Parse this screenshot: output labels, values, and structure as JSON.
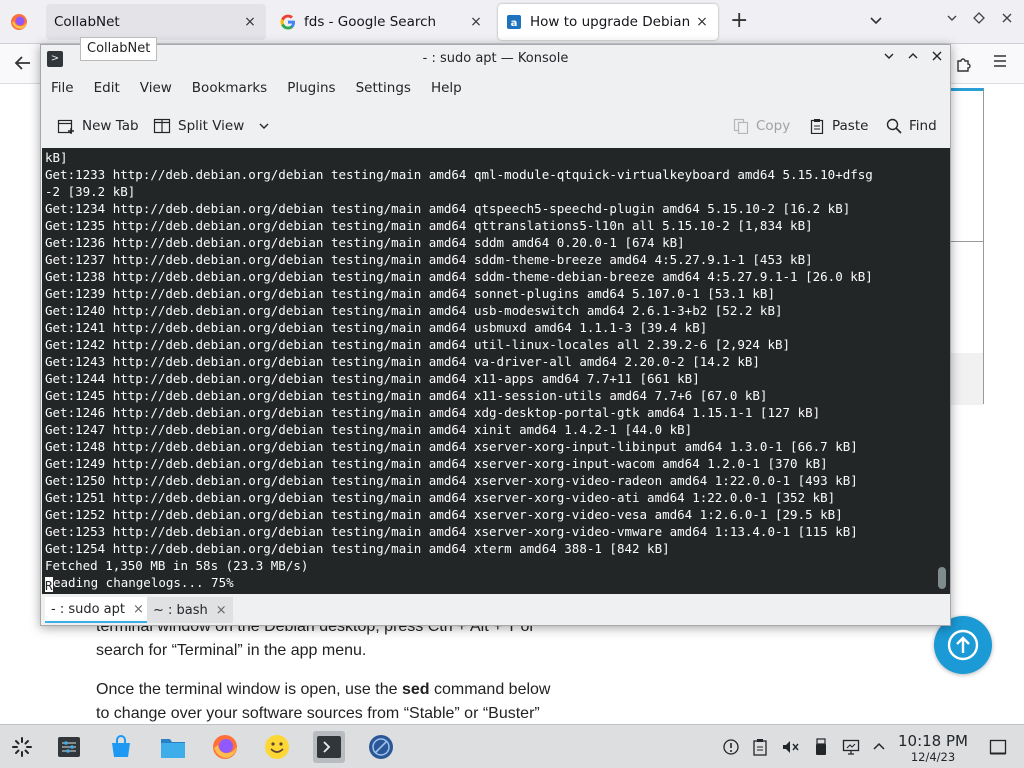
{
  "browser": {
    "tabs": [
      {
        "title": "CollabNet",
        "icon": "collabnet-favicon"
      },
      {
        "title": "fds - Google Search",
        "icon": "google-favicon"
      },
      {
        "title": "How to upgrade Debian di",
        "icon": "article-favicon"
      }
    ],
    "tooltip": "CollabNet",
    "new_tab": "+",
    "tab_close": "×"
  },
  "page": {
    "partial_paragraph": "terminal window on the Debian desktop, press Ctrl + Alt + T or search for “Terminal” in the app menu.",
    "paragraph_pre": "Once the terminal window is open, use the ",
    "paragraph_bold": "sed",
    "paragraph_post": " command below to change over your software sources from “Stable” or “Buster”"
  },
  "konsole": {
    "title": "- : sudo apt — Konsole",
    "menu": [
      "File",
      "Edit",
      "View",
      "Bookmarks",
      "Plugins",
      "Settings",
      "Help"
    ],
    "toolbar": {
      "new_tab": "New Tab",
      "split_view": "Split View",
      "copy": "Copy",
      "paste": "Paste",
      "find": "Find"
    },
    "terminal_lines": [
      "kB]",
      "Get:1233 http://deb.debian.org/debian testing/main amd64 qml-module-qtquick-virtualkeyboard amd64 5.15.10+dfsg",
      "-2 [39.2 kB]",
      "Get:1234 http://deb.debian.org/debian testing/main amd64 qtspeech5-speechd-plugin amd64 5.15.10-2 [16.2 kB]",
      "Get:1235 http://deb.debian.org/debian testing/main amd64 qttranslations5-l10n all 5.15.10-2 [1,834 kB]",
      "Get:1236 http://deb.debian.org/debian testing/main amd64 sddm amd64 0.20.0-1 [674 kB]",
      "Get:1237 http://deb.debian.org/debian testing/main amd64 sddm-theme-breeze amd64 4:5.27.9.1-1 [453 kB]",
      "Get:1238 http://deb.debian.org/debian testing/main amd64 sddm-theme-debian-breeze amd64 4:5.27.9.1-1 [26.0 kB]",
      "Get:1239 http://deb.debian.org/debian testing/main amd64 sonnet-plugins amd64 5.107.0-1 [53.1 kB]",
      "Get:1240 http://deb.debian.org/debian testing/main amd64 usb-modeswitch amd64 2.6.1-3+b2 [52.2 kB]",
      "Get:1241 http://deb.debian.org/debian testing/main amd64 usbmuxd amd64 1.1.1-3 [39.4 kB]",
      "Get:1242 http://deb.debian.org/debian testing/main amd64 util-linux-locales all 2.39.2-6 [2,924 kB]",
      "Get:1243 http://deb.debian.org/debian testing/main amd64 va-driver-all amd64 2.20.0-2 [14.2 kB]",
      "Get:1244 http://deb.debian.org/debian testing/main amd64 x11-apps amd64 7.7+11 [661 kB]",
      "Get:1245 http://deb.debian.org/debian testing/main amd64 x11-session-utils amd64 7.7+6 [67.0 kB]",
      "Get:1246 http://deb.debian.org/debian testing/main amd64 xdg-desktop-portal-gtk amd64 1.15.1-1 [127 kB]",
      "Get:1247 http://deb.debian.org/debian testing/main amd64 xinit amd64 1.4.2-1 [44.0 kB]",
      "Get:1248 http://deb.debian.org/debian testing/main amd64 xserver-xorg-input-libinput amd64 1.3.0-1 [66.7 kB]",
      "Get:1249 http://deb.debian.org/debian testing/main amd64 xserver-xorg-input-wacom amd64 1.2.0-1 [370 kB]",
      "Get:1250 http://deb.debian.org/debian testing/main amd64 xserver-xorg-video-radeon amd64 1:22.0.0-1 [493 kB]",
      "Get:1251 http://deb.debian.org/debian testing/main amd64 xserver-xorg-video-ati amd64 1:22.0.0-1 [352 kB]",
      "Get:1252 http://deb.debian.org/debian testing/main amd64 xserver-xorg-video-vesa amd64 1:2.6.0-1 [29.5 kB]",
      "Get:1253 http://deb.debian.org/debian testing/main amd64 xserver-xorg-video-vmware amd64 1:13.4.0-1 [115 kB]",
      "Get:1254 http://deb.debian.org/debian testing/main amd64 xterm amd64 388-1 [842 kB]",
      "Fetched 1,350 MB in 58s (23.3 MB/s)"
    ],
    "prompt_cursor_char": "R",
    "prompt_rest": "eading changelogs... 75%",
    "tabs": [
      {
        "label": "- : sudo apt"
      },
      {
        "label": "~ : bash"
      }
    ],
    "tab_close": "×"
  },
  "taskbar": {
    "time": "10:18 PM",
    "date": "12/4/23"
  },
  "colors": {
    "terminal_bg": "#232627",
    "terminal_fg": "#fcfcfc",
    "accent": "#3daee9",
    "scroll_top_button": "#1b9ad6"
  }
}
